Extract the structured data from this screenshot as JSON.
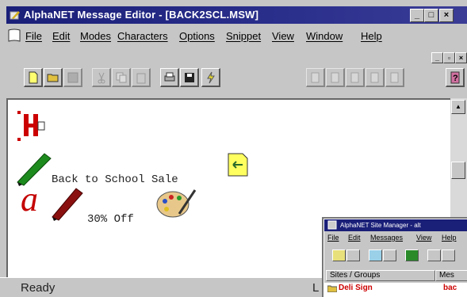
{
  "window": {
    "title": "AlphaNET Message Editor - [BACK2SCL.MSW]",
    "caption_buttons": [
      "minimize",
      "maximize",
      "close"
    ]
  },
  "menu": {
    "items": [
      "File",
      "Edit",
      "Modes",
      "Characters",
      "Options",
      "Snippet",
      "View",
      "Window",
      "Help"
    ]
  },
  "toolbar": {
    "buttons": [
      "new",
      "open",
      "save",
      "cut",
      "copy",
      "paste",
      "print",
      "save-disk",
      "lightning",
      "page-1",
      "page-2",
      "page-3",
      "page-4",
      "page-5",
      "help"
    ]
  },
  "message": {
    "line1": "Back to School Sale",
    "line2": "30% Off"
  },
  "status": {
    "ready": "Ready",
    "indicator": "L"
  },
  "site_manager": {
    "title": "AlphaNET Site Manager - alt",
    "menu": [
      "File",
      "Edit",
      "Messages",
      "View",
      "Help"
    ],
    "columns": [
      "Sites / Groups",
      "Mes"
    ],
    "rows": [
      {
        "site": "Deli Sign",
        "message": "bac"
      }
    ]
  }
}
